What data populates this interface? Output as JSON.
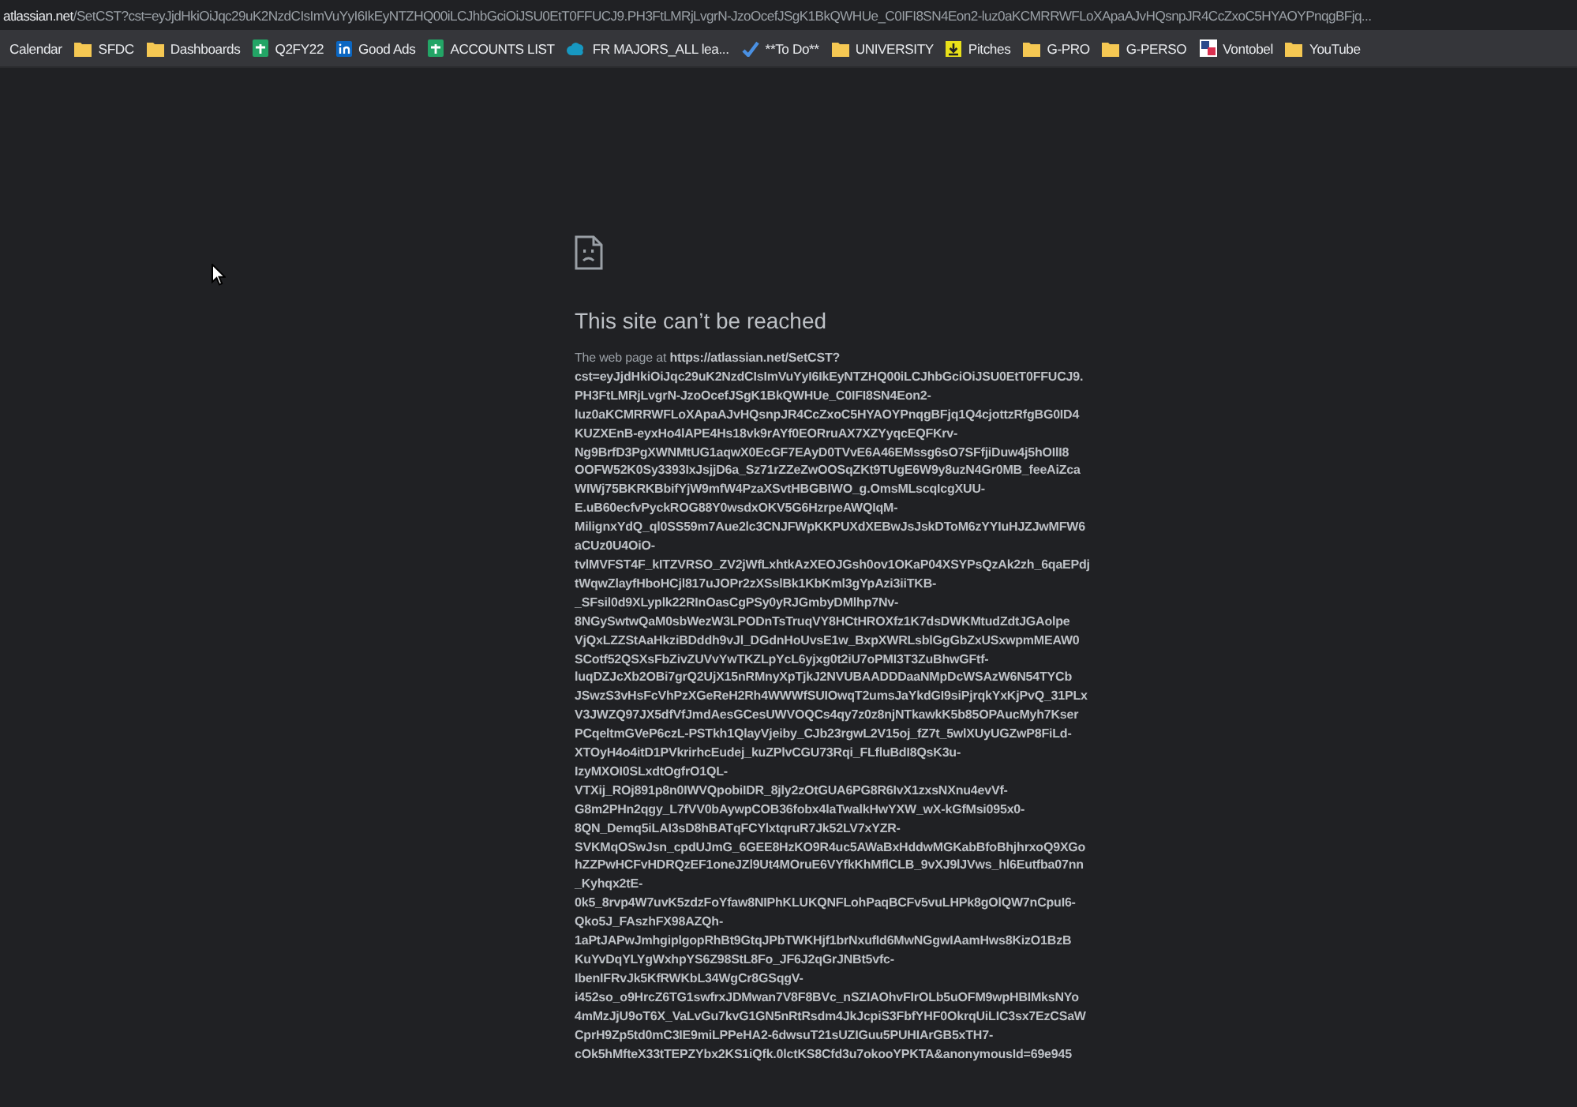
{
  "address_bar": {
    "host": "atlassian.net",
    "path": "/SetCST?cst=eyJjdHkiOiJqc29uK2NzdCIsImVuYyI6IkEyNTZHQ00iLCJhbGciOiJSU0EtT0FFUCJ9.PH3FtLMRjLvgrN-JzoOcefJSgK1BkQWHUe_C0IFI8SN4Eon2-luz0aKCMRRWFLoXApaAJvHQsnpJR4CcZxoC5HYAOYPnqgBFjq..."
  },
  "bookmarks": [
    {
      "label": "Calendar",
      "kind": "none"
    },
    {
      "label": "SFDC",
      "kind": "folder"
    },
    {
      "label": "Dashboards",
      "kind": "folder"
    },
    {
      "label": "Q2FY22",
      "kind": "sheet"
    },
    {
      "label": "Good Ads",
      "kind": "linkedin"
    },
    {
      "label": "ACCOUNTS LIST",
      "kind": "sheet"
    },
    {
      "label": "FR MAJORS_ALL lea...",
      "kind": "cloud"
    },
    {
      "label": "**To Do**",
      "kind": "check"
    },
    {
      "label": "UNIVERSITY",
      "kind": "folder"
    },
    {
      "label": "Pitches",
      "kind": "download"
    },
    {
      "label": "G-PRO",
      "kind": "folder"
    },
    {
      "label": "G-PERSO",
      "kind": "folder"
    },
    {
      "label": "Vontobel",
      "kind": "squares"
    },
    {
      "label": "YouTube",
      "kind": "folder"
    }
  ],
  "error": {
    "title": "This site can’t be reached",
    "lines": [
      "The web page at **https://atlassian.net/SetCST?**",
      "cst=eyJjdHkiOiJqc29uK2NzdCIsImVuYyI6IkEyNTZHQ00iLCJhbGciOiJSU0EtT0FFUCJ9.",
      "PH3FtLMRjLvgrN-JzoOcefJSgK1BkQWHUe_C0IFI8SN4Eon2-",
      "luz0aKCMRRWFLoXApaAJvHQsnpJR4CcZxoC5HYAOYPnqgBFjq1Q4cjottzRfgBG0ID4",
      "KUZXEnB-eyxHo4lAPE4Hs18vk9rAYf0EORruAX7XZYyqcEQFKrv-",
      "Ng9BrfD3PgXWNMtUG1aqwX0EcGF7EAyD0TVvE6A46EMssg6sO7SFfjiDuw4j5hOIlI8",
      "OOFW52K0Sy3393IxJsjjD6a_Sz71rZZeZwOOSqZKt9TUgE6W9y8uzN4Gr0MB_feeAiZca",
      "WIWj75BKRKBbifYjW9mfW4PzaXSvtHBGBIWO_g.OmsMLscqIcgXUU-",
      "E.uB60ecfvPyckROG88Y0wsdxOKV5G6HzrpeAWQIqM-",
      "MilignxYdQ_ql0SS59m7Aue2lc3CNJFWpKKPUXdXEBwJsJskDToM6zYYIuHJZJwMFW6",
      "aCUz0U4OiO-",
      "tvlMVFST4F_kITZVRSO_ZV2jWfLxhtkAzXEOJGsh0ov1OKaP04XSYPsQzAk2zh_6qaEPdj",
      "tWqwZlayfHboHCjl817uJOPr2zXSslBk1KbKml3gYpAzi3iiTKB-",
      "_SFsil0d9XLyplk22RInOasCgPSy0yRJGmbyDMlhp7Nv-",
      "8NGySwtwQaM0sbWezW3LPODnTsTruqVY8HCtHROXfz1K7dsDWKMtudZdtJGAolpe",
      "VjQxLZZStAaHkziBDddh9vJl_DGdnHoUvsE1w_BxpXWRLsblGgGbZxUSxwpmMEAW0",
      "SCotf52QSXsFbZivZUVvYwTKZLpYcL6yjxg0t2iU7oPMI3T3ZuBhwGFtf-",
      "luqDZJcXb2OBi7grQ2UjX15nRMnyXpTjkJ2NVUBAADDDaaNMpDcWSAzW6N54TYCb",
      "JSwzS3vHsFcVhPzXGeReH2Rh4WWWfSUIOwqT2umsJaYkdGI9siPjrqkYxKjPvQ_31PLx",
      "V3JWZQ97JX5dfVfJmdAesGCesUWVOQCs4qy7z0z8njNTkawkK5b85OPAucMyh7Kser",
      "PCqeltmGVeP6czL-PSTkh1QlayVjeiby_CJb23rgwL2V15oj_fZ7t_5wlXUyUGZwP8FiLd-",
      "XTOyH4o4itD1PVkrirhcEudej_kuZPlvCGU73Rqi_FLfluBdI8QsK3u-",
      "IzyMXOI0SLxdtOgfrO1QL-",
      "VTXij_ROj891p8n0IWVQpobiIDR_8jly2zOtGUA6PG8R6IvX1zxsNXnu4evVf-",
      "G8m2PHn2qgy_L7fVV0bAywpCOB36fobx4laTwalkHwYXW_wX-kGfMsi095x0-",
      "8QN_Demq5iLAI3sD8hBATqFCYlxtqruR7Jk52LV7xYZR-",
      "SVKMqOSwJsn_cpdUJmG_6GEE8HzKO9R4uc5AWaBxHddwMGKabBfoBhjhrxoQ9XGo",
      "hZZPwHCFvHDRQzEF1oneJZl9Ut4MOruE6VYfkKhMflCLB_9vXJ9lJVws_hl6Eutfba07nn",
      "_Kyhqx2tE-",
      "0k5_8rvp4W7uvK5zdzFoYfaw8NIPhKLUKQNFLohPaqBCFv5vuLHPk8gOlQW7nCpuI6-",
      "Qko5J_FAszhFX98AZQh-",
      "1aPtJAPwJmhgiplgopRhBt9GtqJPbTWKHjf1brNxufId6MwNGgwIAamHws8KizO1BzB",
      "KuYvDqYLYgWxhpYS6Z98StL8Fo_JF6J2qGrJNBt5vfc-",
      "IbenIFRvJk5KfRWKbL34WgCr8GSqgV-",
      "i452so_o9HrcZ6TG1swfrxJDMwan7V8F8BVc_nSZIAOhvFIrOLb5uOFM9wpHBIMksNYo",
      "4mMzJjU9oT6X_VaLvGu7kvG1GN5nRtRsdm4JkJcpiS3FbfYHF0OkrqUiLIC3sx7EzCSaW",
      "CprH9Zp5td0mC3IE9miLPPeHA2-6dwsuT21sUZIGuu5PUHIArGB5xTH7-",
      "cOk5hMfteX33tTEPZYbx2KS1iQfk.0lctKS8Cfd3u7okooYPKTA&anonymousId=69e945"
    ]
  }
}
